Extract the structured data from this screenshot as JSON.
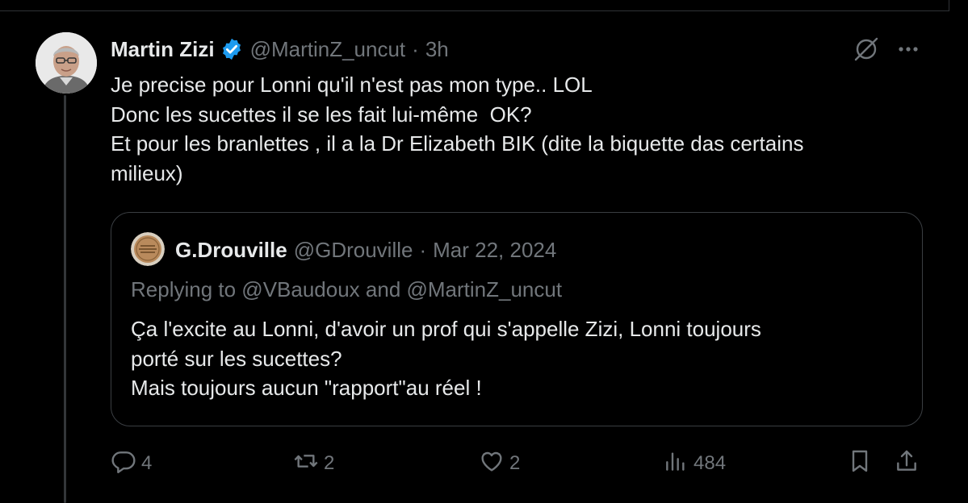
{
  "tweet": {
    "author_name": "Martin Zizi",
    "author_handle": "@MartinZ_uncut",
    "separator": "·",
    "time": "3h",
    "lines": [
      "Je precise pour Lonni qu'il n'est pas mon type.. LOL",
      "Donc les sucettes il se les fait lui-même  OK?",
      "Et pour les branlettes , il a la Dr Elizabeth BIK (dite la biquette das certains",
      "milieux)"
    ]
  },
  "quote": {
    "author_name": "G.Drouville",
    "author_handle": "@GDrouville",
    "separator": "·",
    "date": "Mar 22, 2024",
    "replying": "Replying to @VBaudoux and @MartinZ_uncut",
    "lines": [
      "Ça l'excite au Lonni, d'avoir un prof qui s'appelle Zizi, Lonni toujours",
      "porté sur les sucettes?",
      "Mais toujours aucun \"rapport\"au réel !"
    ]
  },
  "actions": {
    "replies": "4",
    "reposts": "2",
    "likes": "2",
    "views": "484"
  },
  "icons": [
    "verified-badge-icon",
    "grok-icon",
    "more-icon",
    "reply-icon",
    "repost-icon",
    "like-icon",
    "views-icon",
    "bookmark-icon",
    "share-icon"
  ],
  "colors": {
    "background": "#000000",
    "text": "#e7e9ea",
    "muted": "#71767b",
    "verified": "#1d9bf0",
    "border": "#2f3336"
  }
}
